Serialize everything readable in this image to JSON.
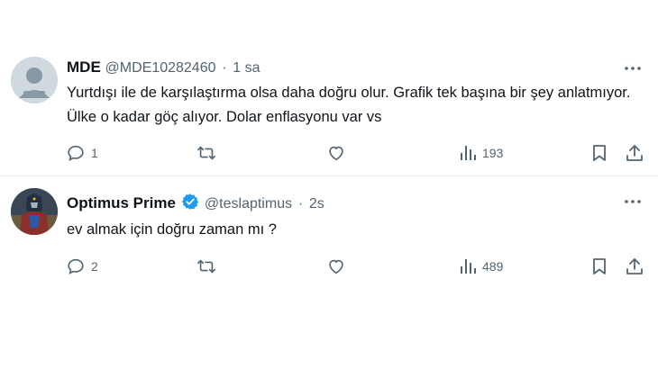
{
  "tweets": [
    {
      "name": "MDE",
      "handle": "@MDE10282460",
      "time": "1 sa",
      "text": "Yurtdışı ile de karşılaştırma olsa daha doğru olur. Grafik tek başına bir şey anlatmıyor. Ülke o kadar göç alıyor. Dolar enflasyonu var vs",
      "reply_count": "1",
      "views": "193"
    },
    {
      "name": "Optimus Prime",
      "handle": "@teslaptimus",
      "time": "2s",
      "text": "ev almak için doğru zaman mı ?",
      "reply_count": "2",
      "views": "489",
      "verified": true
    }
  ],
  "separator": "·",
  "colors": {
    "verified": "#1d9bf0",
    "muted": "#536471",
    "divider": "#e6ecf0"
  },
  "icons": [
    "more-icon",
    "reply-icon",
    "retweet-icon",
    "like-icon",
    "views-icon",
    "bookmark-icon",
    "share-icon",
    "verified-badge-icon",
    "default-avatar-icon"
  ]
}
